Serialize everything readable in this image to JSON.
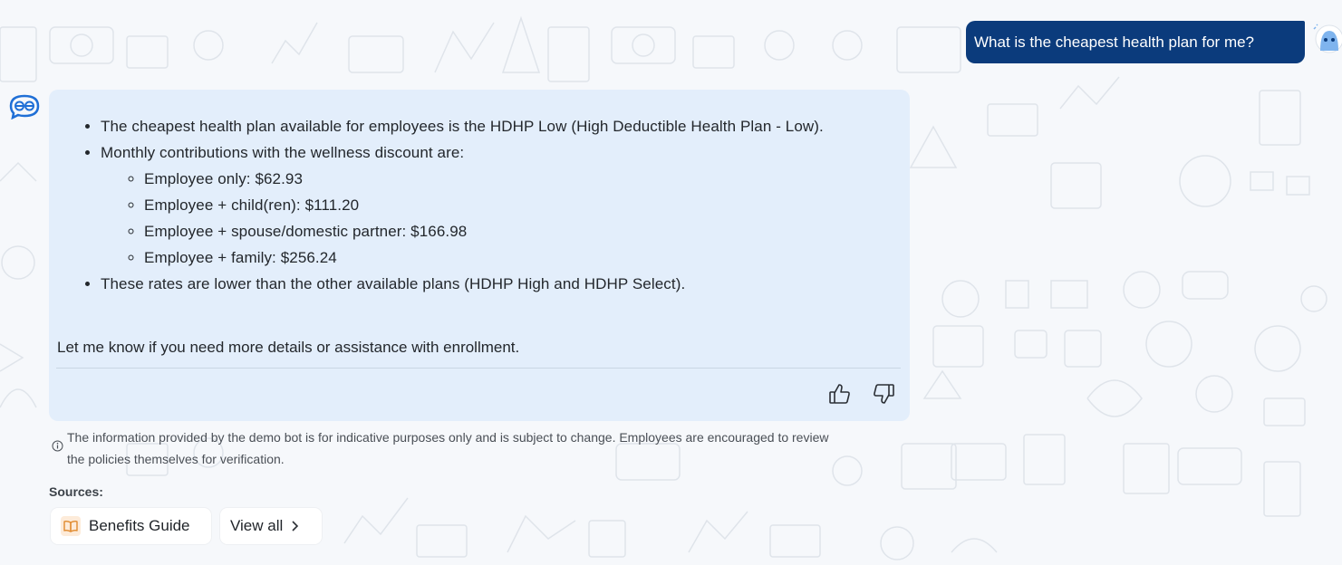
{
  "user_message": {
    "text": "What is the cheapest health plan for me?"
  },
  "bot_message": {
    "items": [
      "The cheapest health plan available for employees is the HDHP Low (High Deductible Health Plan - Low).",
      "Monthly contributions with the wellness discount are:",
      "These rates are lower than the other available plans (HDHP High and HDHP Select)."
    ],
    "sub_items": [
      "Employee only: $62.93",
      "Employee + child(ren): $111.20",
      "Employee + spouse/domestic partner: $166.98",
      "Employee + family: $256.24"
    ],
    "closing": "Let me know if you need more details or assistance with enrollment."
  },
  "disclaimer": {
    "text": "The information provided by the demo bot is for indicative purposes only and is subject to change. Employees are encouraged to review the policies themselves for verification."
  },
  "sources": {
    "label": "Sources:",
    "items": [
      "Benefits Guide"
    ],
    "view_all_label": "View all"
  },
  "colors": {
    "user_bubble": "#0b3b7c",
    "bot_bubble": "#e3eefb",
    "background": "#f6f8fb",
    "accent": "#1f6fd6"
  }
}
